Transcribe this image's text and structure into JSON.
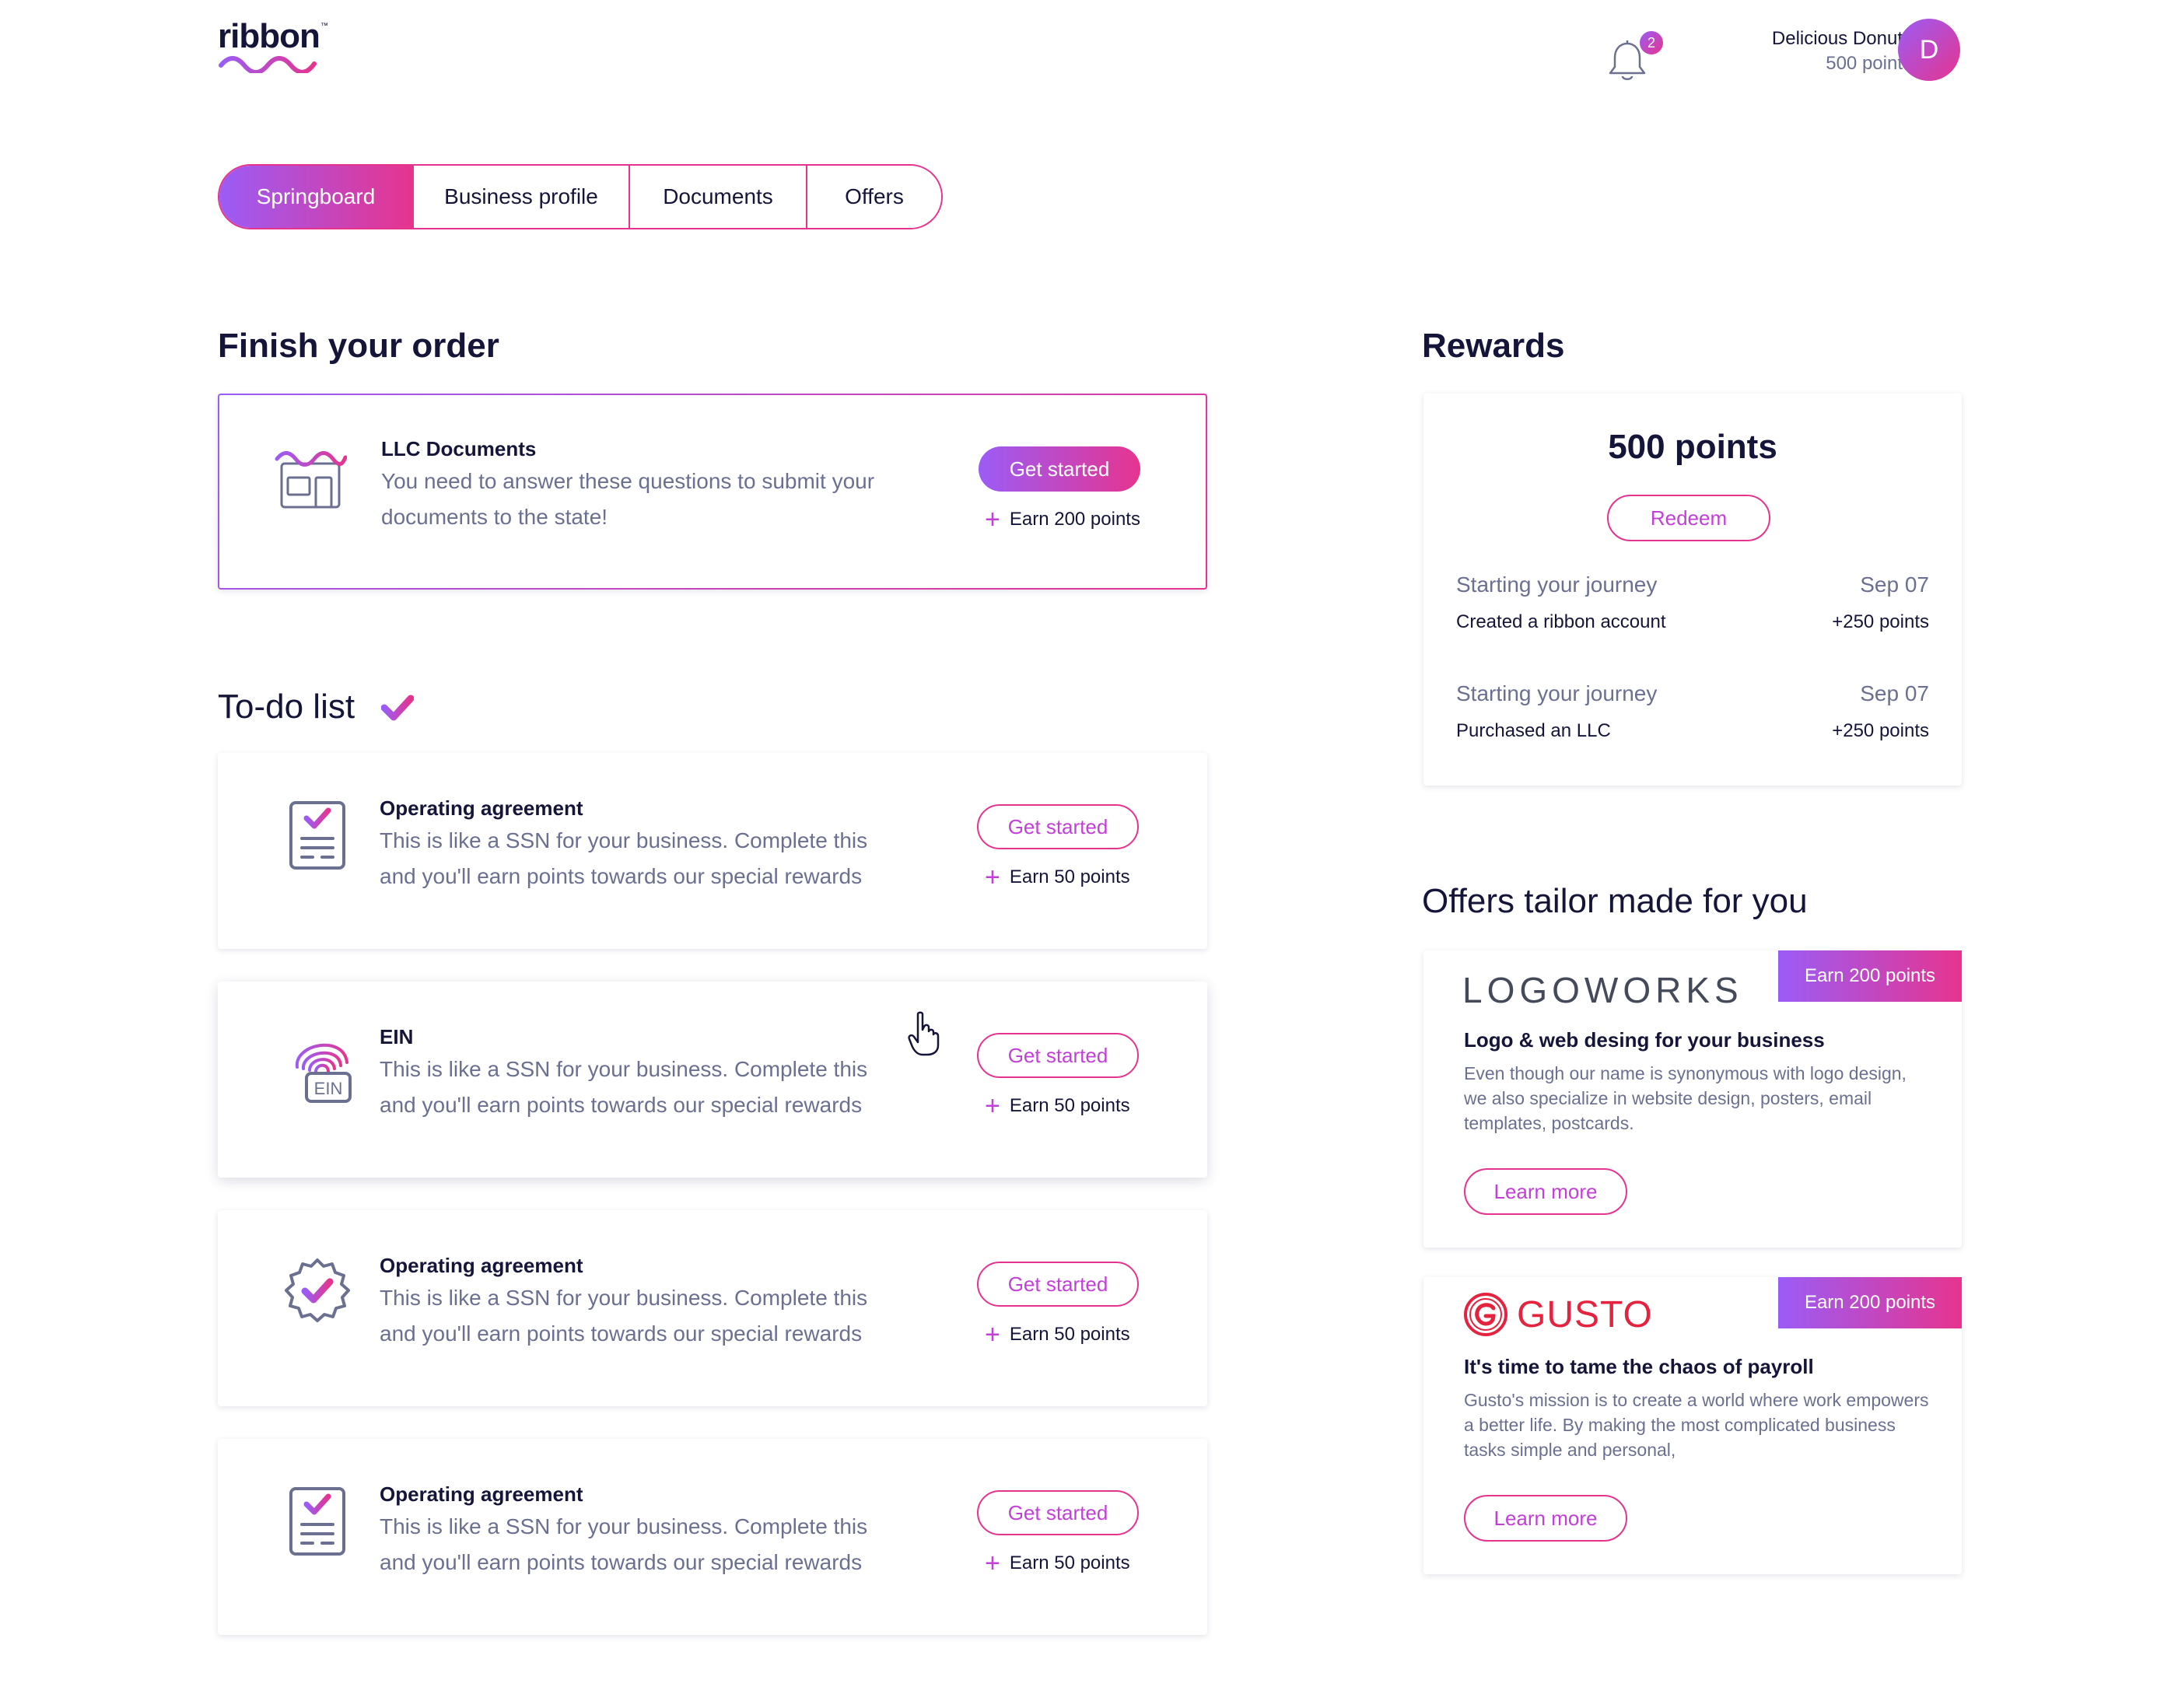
{
  "header": {
    "logo": "ribbon",
    "notifications_count": "2",
    "user_name": "Delicious Donuts",
    "user_points": "500 points",
    "avatar_initial": "D"
  },
  "tabs": [
    {
      "label": "Springboard",
      "active": true
    },
    {
      "label": "Business profile",
      "active": false
    },
    {
      "label": "Documents",
      "active": false
    },
    {
      "label": "Offers",
      "active": false
    }
  ],
  "finish_order": {
    "title": "Finish your order",
    "item": {
      "title": "LLC Documents",
      "description": "You need to answer these questions to submit your documents to the state!",
      "button": "Get started",
      "earn": "Earn 200 points",
      "icon": "storefront-icon"
    }
  },
  "todo": {
    "title": "To-do list",
    "items": [
      {
        "title": "Operating agreement",
        "description": "This is like a SSN for your business. Complete this and you'll earn points towards our special rewards",
        "button": "Get started",
        "earn": "Earn 50 points",
        "icon": "checklist-icon"
      },
      {
        "title": "EIN",
        "description": "This is like a SSN for your business. Complete this and you'll earn points towards our special rewards",
        "button": "Get started",
        "earn": "Earn 50 points",
        "icon": "fingerprint-icon",
        "icon_label": "EIN"
      },
      {
        "title": "Operating agreement",
        "description": "This is like a SSN for your business. Complete this and you'll earn points towards our special rewards",
        "button": "Get started",
        "earn": "Earn 50 points",
        "icon": "verified-badge-icon"
      },
      {
        "title": "Operating agreement",
        "description": "This is like a SSN for your business. Complete this and you'll earn points towards our special rewards",
        "button": "Get started",
        "earn": "Earn 50 points",
        "icon": "checklist-icon"
      }
    ]
  },
  "rewards": {
    "title": "Rewards",
    "total": "500 points",
    "redeem": "Redeem",
    "history": [
      {
        "category": "Starting your journey",
        "date": "Sep 07",
        "detail": "Created a ribbon account",
        "points": "+250 points"
      },
      {
        "category": "Starting your journey",
        "date": "Sep 07",
        "detail": "Purchased an LLC",
        "points": "+250 points"
      }
    ]
  },
  "offers": {
    "title": "Offers tailor made for you",
    "items": [
      {
        "brand": "LOGOWORKS",
        "badge": "Earn 200 points",
        "title": "Logo & web desing for your business",
        "description": "Even though our name is synonymous with logo design, we also specialize in website design, posters, email templates, postcards.",
        "button": "Learn more"
      },
      {
        "brand": "GUSTO",
        "badge": "Earn 200 points",
        "title": "It's time to tame the chaos of payroll",
        "description": "Gusto's mission is to create a world where work empowers a better life. By making the most complicated business tasks simple and personal,",
        "button": "Learn more"
      }
    ]
  },
  "colors": {
    "accent_start": "#9b5cf6",
    "accent_end": "#e6348e",
    "text_dark": "#15153a",
    "text_muted": "#6b7090"
  }
}
